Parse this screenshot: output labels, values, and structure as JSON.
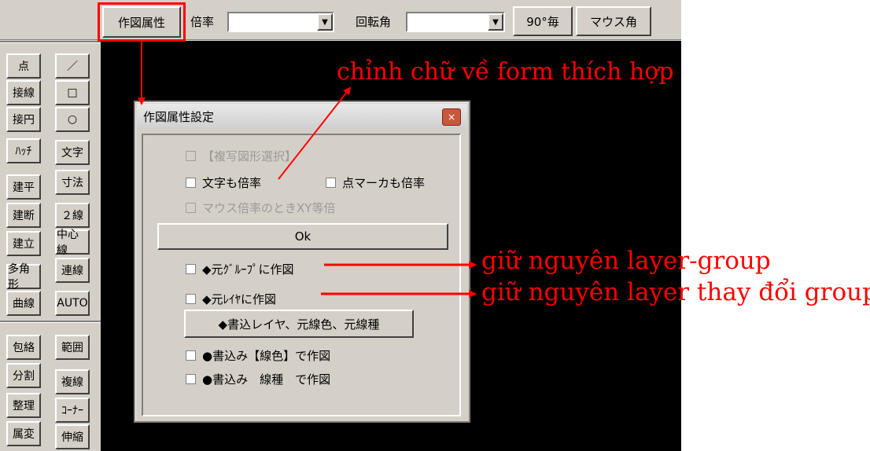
{
  "toolbar": {
    "attr_button": "作図属性",
    "scale_label": "倍率",
    "scale_value": "",
    "rotation_label": "回転角",
    "rotation_value": "",
    "every90_button": "90°毎",
    "mouse_angle_button": "マウス角"
  },
  "palette": {
    "left": [
      "点",
      "接線",
      "接円",
      "ﾊｯﾁ",
      "建平",
      "建断",
      "建立",
      "多角形",
      "曲線",
      "包絡",
      "分割",
      "整理",
      "属変"
    ],
    "right": [
      "／",
      "□",
      "○",
      "文字",
      "寸法",
      "２線",
      "中心線",
      "連線",
      "AUTO",
      "範囲",
      "複線",
      "ｺｰﾅｰ",
      "伸縮"
    ]
  },
  "dialog": {
    "title": "作図属性設定",
    "close_symbol": "×",
    "copy_shape_select": "【複写図形選択】",
    "text_scale": "文字も倍率",
    "point_marker_scale": "点マーカも倍率",
    "mouse_xy_equal": "マウス倍率のときXY等倍",
    "ok_button": "Ok",
    "orig_group": "◆元ｸﾞﾙｰﾌﾟに作図",
    "orig_layer": "◆元ﾚｲﾔに作図",
    "write_layer_button": "◆書込レイヤ、元線色、元線種",
    "write_color": "●書込み【線色】で作図",
    "write_linetype": "●書込み　線種　で作図"
  },
  "annotations": {
    "text_form": "chỉnh chữ về form thích hợp",
    "keep_layer_group": "giữ nguyên layer-group",
    "keep_layer_change_group": "giữ nguyên layer thay đổi group",
    "color": "#ff0000"
  }
}
